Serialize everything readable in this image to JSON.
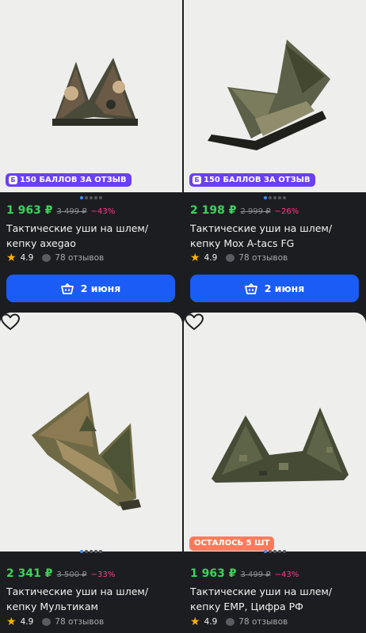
{
  "products": [
    {
      "badge": "150 БАЛЛОВ ЗА ОТЗЫВ",
      "badge_icon": "Б",
      "price": "1 963 ₽",
      "old_price": "3 499 ₽",
      "discount": "−43%",
      "title": "Тактические уши на шлем/кепку axegao",
      "rating": "4.9",
      "reviews": "78 отзывов",
      "button": "2 июня",
      "camo_colors": [
        "#4a4a3b",
        "#6b5a45",
        "#c9b08a",
        "#2d2f27"
      ]
    },
    {
      "badge": "150 БАЛЛОВ ЗА ОТЗЫВ",
      "badge_icon": "Б",
      "price": "2 198 ₽",
      "old_price": "2 999 ₽",
      "discount": "−26%",
      "title": "Тактические уши на шлем/кепку Mox A-tacs FG",
      "rating": "4.9",
      "reviews": "78 отзывов",
      "button": "2 июня",
      "camo_colors": [
        "#5c6048",
        "#7b7c5e",
        "#43472f",
        "#8f8d6c"
      ]
    },
    {
      "price": "2 341 ₽",
      "old_price": "3 500 ₽",
      "discount": "−33%",
      "title": "Тактические уши на шлем/кепку Мультикам",
      "rating": "4.9",
      "reviews": "78 отзывов",
      "camo_colors": [
        "#6f6a46",
        "#8b7a52",
        "#4d5335",
        "#a39064"
      ]
    },
    {
      "left_badge": "ОСТАЛОСЬ 5 ШТ",
      "price": "1 963 ₽",
      "old_price": "3 499 ₽",
      "discount": "−43%",
      "title": "Тактические уши на шлем/кепку EMP, Цифра РФ",
      "rating": "4.9",
      "reviews": "78 отзывов",
      "camo_colors": [
        "#454b34",
        "#5e6447",
        "#767a58",
        "#33382a"
      ]
    }
  ],
  "colors": {
    "background": "#1c1d20",
    "price": "#3bd35a",
    "discount": "#ff3b8e",
    "badge": "#6a3ff5",
    "left_badge": "#ff7a5c",
    "button": "#1a5cf5"
  },
  "icons": {
    "rating": "star-icon",
    "reviews": "chat-bubble-icon",
    "buy": "cart-icon",
    "favorite": "heart-icon"
  }
}
